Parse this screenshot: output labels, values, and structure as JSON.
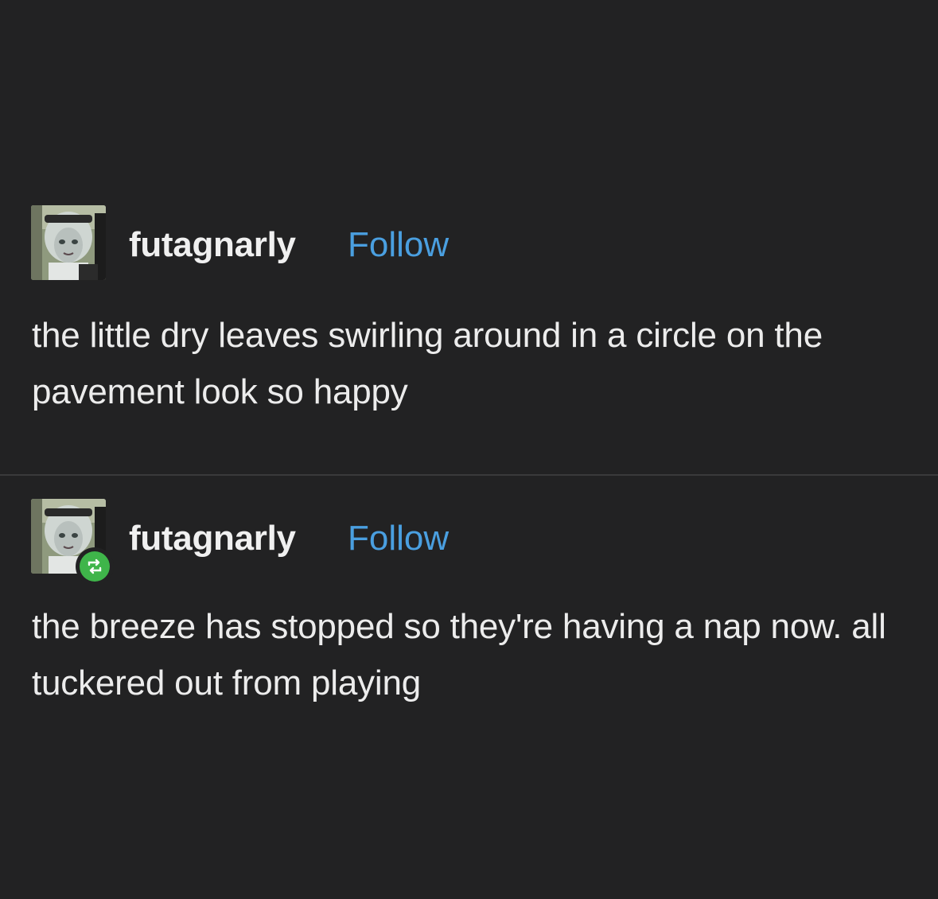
{
  "posts": [
    {
      "username": "futagnarly",
      "follow_label": "Follow",
      "text": "the little dry leaves swirling around in a circle on the pavement look so happy",
      "avatar_icon": "user-avatar",
      "reblog": false
    },
    {
      "username": "futagnarly",
      "follow_label": "Follow",
      "text": "the breeze has stopped so they're having a nap now. all tuckered out from playing",
      "avatar_icon": "user-avatar",
      "reblog": true,
      "reblog_icon": "reblog-icon"
    }
  ],
  "colors": {
    "background": "#222223",
    "text": "#ececec",
    "follow": "#4a9fe0",
    "reblog_badge": "#3fb54a",
    "divider": "#3a3a3b"
  }
}
